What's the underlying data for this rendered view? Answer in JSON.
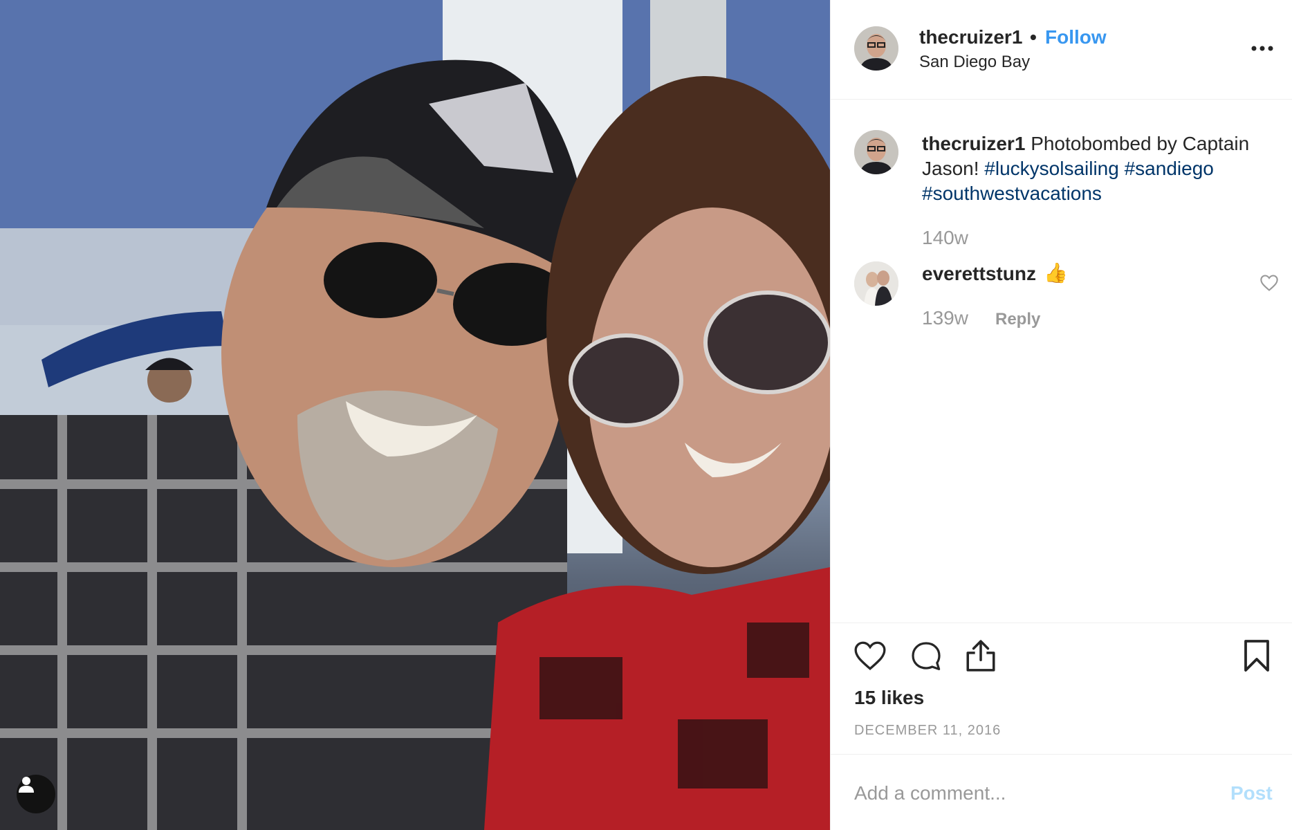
{
  "post": {
    "username": "thecruizer1",
    "separator": "•",
    "follow_label": "Follow",
    "location": "San Diego Bay",
    "more_icon": "more-horizontal-icon",
    "caption": {
      "username": "thecruizer1",
      "text": "Photobombed by Captain Jason!",
      "hashtags": [
        "#luckysolsailing",
        "#sandiego",
        "#southwestvacations"
      ],
      "time": "140w"
    },
    "comments": [
      {
        "username": "everettstunz",
        "emoji": "👍",
        "time": "139w",
        "reply_label": "Reply",
        "like_icon": "heart-outline-icon"
      }
    ],
    "actions": {
      "like_icon": "heart-icon",
      "comment_icon": "comment-bubble-icon",
      "share_icon": "share-upload-icon",
      "save_icon": "bookmark-icon"
    },
    "likes": "15 likes",
    "date": "DECEMBER 11, 2016",
    "add_comment": {
      "placeholder": "Add a comment...",
      "post_label": "Post"
    },
    "colors": {
      "follow": "#3897f0",
      "hashtag": "#003569",
      "muted": "#999999",
      "post_disabled": "#b2dffc"
    }
  }
}
